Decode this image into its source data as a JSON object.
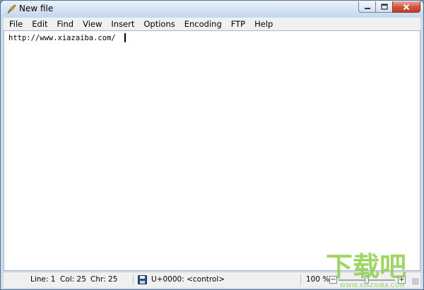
{
  "window": {
    "title": "New file",
    "app_icon": "quill-pen-icon",
    "controls": {
      "minimize_icon": "minimize-icon",
      "maximize_icon": "maximize-icon",
      "close_icon": "close-icon"
    }
  },
  "menu": {
    "items": [
      {
        "label": "File"
      },
      {
        "label": "Edit"
      },
      {
        "label": "Find"
      },
      {
        "label": "View"
      },
      {
        "label": "Insert"
      },
      {
        "label": "Options"
      },
      {
        "label": "Encoding"
      },
      {
        "label": "FTP"
      },
      {
        "label": "Help"
      }
    ]
  },
  "editor": {
    "content": "http://www.xiazaiba.com/"
  },
  "statusbar": {
    "line": "Line: 1",
    "col": "Col: 25",
    "chr": "Chr: 25",
    "save_icon": "save-icon",
    "char_info": "U+0000: <control>",
    "zoom": "100 %",
    "zoom_level_percent": 100,
    "zoom_out_label": "−",
    "zoom_in_label": "+"
  },
  "watermark": {
    "text": "下载吧",
    "subtext": "WWW.XIAZAIBA.COM"
  },
  "colors": {
    "watermark": "#8fcf4a",
    "close_button": "#c94a33",
    "titlebar": "#d4e2f1"
  }
}
